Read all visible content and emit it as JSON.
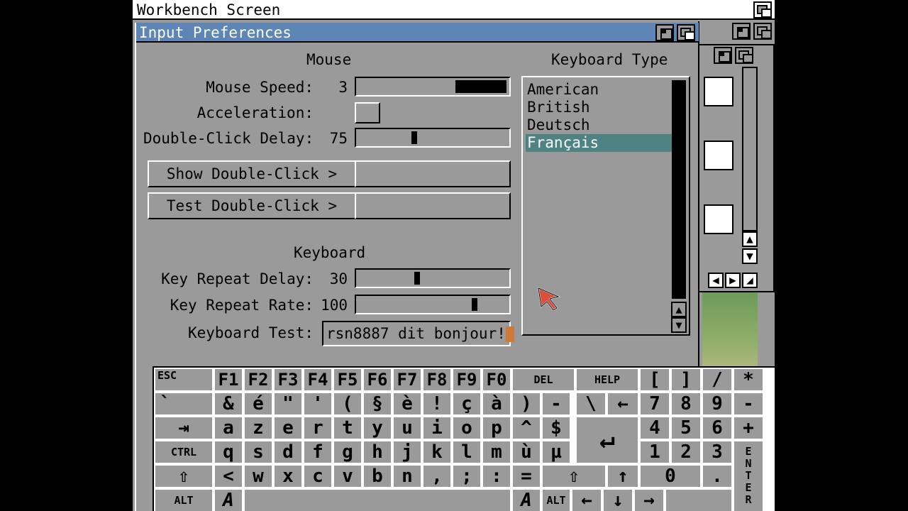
{
  "screen": {
    "title": "Workbench Screen"
  },
  "window": {
    "title": "Input Preferences"
  },
  "mouse": {
    "heading": "Mouse",
    "speed_label": "Mouse Speed:",
    "speed_value": "3",
    "speed_level": 0.85,
    "accel_label": "Acceleration:",
    "dblclick_label": "Double-Click Delay:",
    "dblclick_value": "75",
    "dblclick_level": 0.38,
    "show_btn": "Show Double-Click  >",
    "test_btn": "Test Double-Click  >"
  },
  "keyboard": {
    "heading": "Keyboard",
    "repeat_delay_label": "Key Repeat Delay:",
    "repeat_delay_value": "30",
    "repeat_delay_level": 0.4,
    "repeat_rate_label": "Key Repeat Rate:",
    "repeat_rate_value": "100",
    "repeat_rate_level": 0.8,
    "test_label": "Keyboard Test:",
    "test_value": "rsn8887 dit bonjour!"
  },
  "keyboard_type": {
    "heading": "Keyboard Type",
    "items": [
      "American",
      "British",
      "Deutsch",
      "Français"
    ],
    "selected": 3
  },
  "onscreen_keyboard": {
    "rows": [
      [
        "ESC",
        "F1",
        "F2",
        "F3",
        "F4",
        "F5",
        "F6",
        "F7",
        "F8",
        "F9",
        "F0",
        "DEL",
        "HELP",
        "[",
        "]",
        "/",
        "*"
      ],
      [
        "`",
        "&",
        "é",
        "\"",
        "'",
        "(",
        "§",
        "è",
        "!",
        "ç",
        "à",
        ")",
        "-",
        "\\",
        "←",
        "7",
        "8",
        "9",
        "-"
      ],
      [
        "⇥",
        "a",
        "z",
        "e",
        "r",
        "t",
        "y",
        "u",
        "i",
        "o",
        "p",
        "^",
        "$",
        "↵",
        "4",
        "5",
        "6",
        "+"
      ],
      [
        "CTRL",
        "q",
        "s",
        "d",
        "f",
        "g",
        "h",
        "j",
        "k",
        "l",
        "m",
        "ù",
        "µ",
        "1",
        "2",
        "3",
        "ENTER"
      ],
      [
        "⇧",
        "<",
        "w",
        "x",
        "c",
        "v",
        "b",
        "n",
        ",",
        ";",
        ":",
        "=",
        "⇧",
        "↑",
        "0",
        "."
      ],
      [
        "ALT",
        "A",
        "A",
        "ALT",
        "←",
        "↓",
        "→"
      ]
    ]
  },
  "colors": {
    "titlebar": "#5d85b6",
    "selected": "#4f8282",
    "face": "#9a9a9a",
    "cursor": "#d07a3a"
  }
}
